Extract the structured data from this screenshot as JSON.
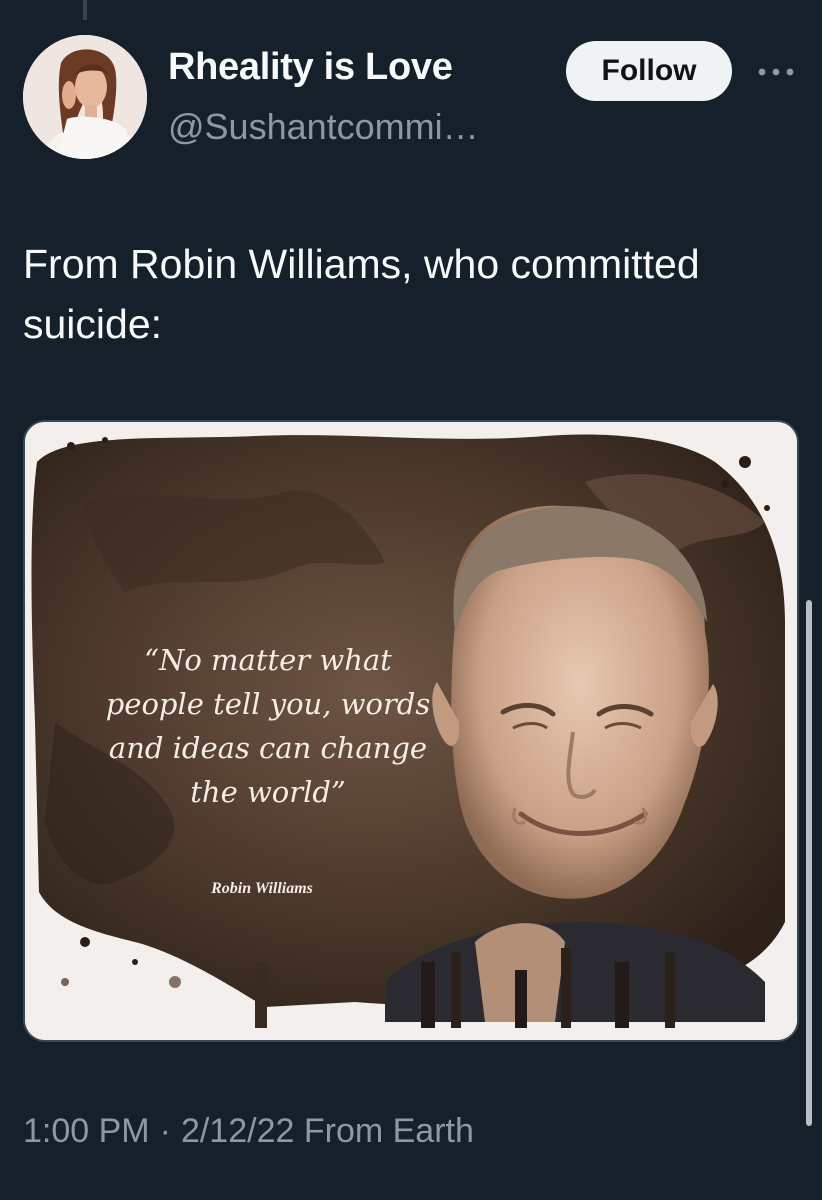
{
  "tweet": {
    "author": {
      "display_name": "Rheality is Love",
      "handle": "@Sushantcommi…"
    },
    "follow_label": "Follow",
    "text": "From Robin Williams, who committed suicide:",
    "media": {
      "quote": "“No matter what people tell you, words and ideas can change the world”",
      "attribution": "Robin Williams"
    },
    "time": "1:00 PM",
    "date": "2/12/22",
    "source": "From Earth"
  },
  "icons": {
    "more": "more-horizontal-icon"
  }
}
